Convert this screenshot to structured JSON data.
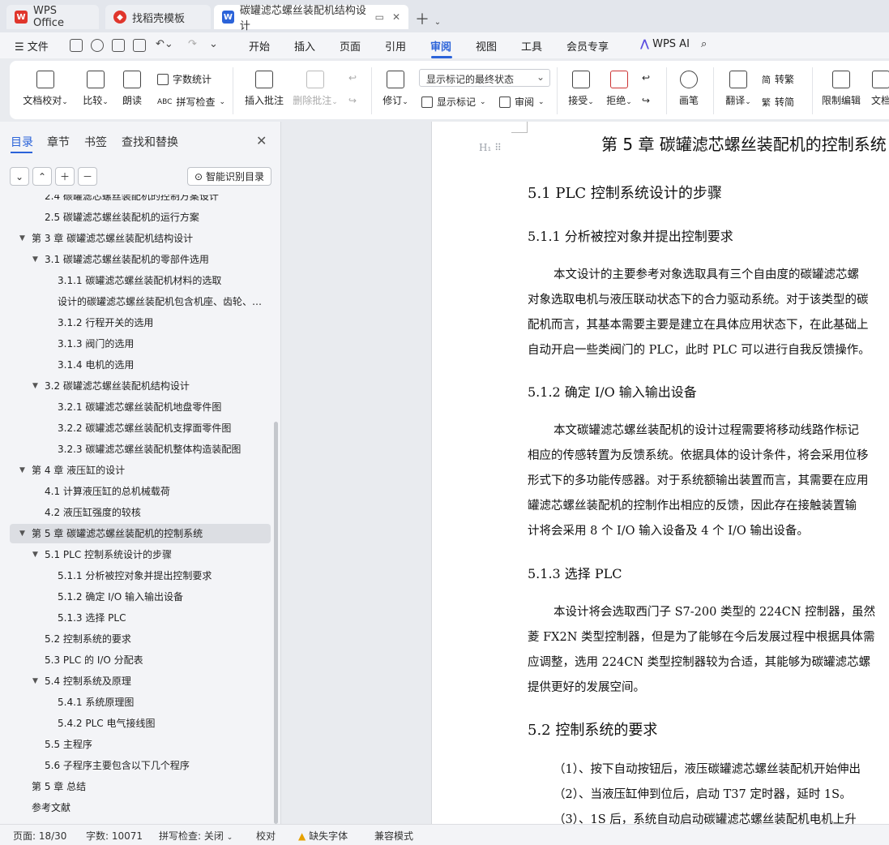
{
  "tabs": {
    "wps": "WPS Office",
    "template": "找稻壳模板",
    "doc": "碳罐滤芯螺丝装配机结构设计"
  },
  "menu": {
    "file": "文件",
    "items": [
      "开始",
      "插入",
      "页面",
      "引用",
      "审阅",
      "视图",
      "工具",
      "会员专享"
    ],
    "ai": "WPS AI"
  },
  "ribbon": {
    "doc_check": "文档校对",
    "compare": "比较",
    "read": "朗读",
    "word_count": "字数统计",
    "spell_check": "拼写检查",
    "insert_comment": "插入批注",
    "delete_comment": "删除批注",
    "revise": "修订",
    "markup_state": "显示标记的最终状态",
    "show_markup": "显示标记",
    "review": "审阅",
    "accept": "接受",
    "reject": "拒绝",
    "pen": "画笔",
    "translate": "翻译",
    "to_trad": "转繁",
    "to_simp": "转简",
    "restrict_edit": "限制编辑",
    "doc_more": "文档"
  },
  "sidebar": {
    "tabs": [
      "目录",
      "章节",
      "书签",
      "查找和替换"
    ],
    "smart_button": "智能识别目录",
    "toc": [
      {
        "text": "2.4 碳罐滤芯螺丝装配机的控制方案设计",
        "level": 2
      },
      {
        "text": "2.5 碳罐滤芯螺丝装配机的运行方案",
        "level": 2
      },
      {
        "text": "第 3 章  碳罐滤芯螺丝装配机结构设计",
        "level": 1,
        "arrow": true
      },
      {
        "text": "3.1 碳罐滤芯螺丝装配机的零部件选用",
        "level": 2,
        "arrow": true
      },
      {
        "text": "3.1.1 碳罐滤芯螺丝装配机材料的选取",
        "level": 3
      },
      {
        "text": "设计的碳罐滤芯螺丝装配机包含机座、齿轮、…",
        "level": 3
      },
      {
        "text": "3.1.2 行程开关的选用",
        "level": 3
      },
      {
        "text": "3.1.3 阀门的选用",
        "level": 3
      },
      {
        "text": "3.1.4 电机的选用",
        "level": 3
      },
      {
        "text": "3.2 碳罐滤芯螺丝装配机结构设计",
        "level": 2,
        "arrow": true
      },
      {
        "text": "3.2.1 碳罐滤芯螺丝装配机地盘零件图",
        "level": 3
      },
      {
        "text": "3.2.2 碳罐滤芯螺丝装配机支撑面零件图",
        "level": 3
      },
      {
        "text": "3.2.3 碳罐滤芯螺丝装配机整体构造装配图",
        "level": 3
      },
      {
        "text": "第 4 章  液压缸的设计",
        "level": 1,
        "arrow": true
      },
      {
        "text": "4.1 计算液压缸的总机械载荷",
        "level": 2
      },
      {
        "text": "4.2 液压缸强度的较核",
        "level": 2
      },
      {
        "text": "第 5 章  碳罐滤芯螺丝装配机的控制系统",
        "level": 1,
        "arrow": true,
        "active": true
      },
      {
        "text": "5.1 PLC 控制系统设计的步骤",
        "level": 2,
        "arrow": true
      },
      {
        "text": "5.1.1 分析被控对象并提出控制要求",
        "level": 3
      },
      {
        "text": "5.1.2 确定 I/O 输入输出设备",
        "level": 3
      },
      {
        "text": "5.1.3 选择 PLC",
        "level": 3
      },
      {
        "text": "5.2 控制系统的要求",
        "level": 2
      },
      {
        "text": "5.3 PLC 的 I/O 分配表",
        "level": 2
      },
      {
        "text": "5.4  控制系统及原理",
        "level": 2,
        "arrow": true
      },
      {
        "text": "5.4.1 系统原理图",
        "level": 3
      },
      {
        "text": "5.4.2 PLC 电气接线图",
        "level": 3
      },
      {
        "text": "5.5 主程序",
        "level": 2
      },
      {
        "text": "5.6 子程序主要包含以下几个程序",
        "level": 2
      },
      {
        "text": "第 5 章  总结",
        "level": 1
      },
      {
        "text": "参考文献",
        "level": 1
      }
    ]
  },
  "document": {
    "heading_marker": "H₁",
    "chapter_title": "第 5 章  碳罐滤芯螺丝装配机的控制系统",
    "h_5_1": "5.1 PLC 控制系统设计的步骤",
    "h_5_1_1": "5.1.1 分析被控对象并提出控制要求",
    "p1": [
      "本文设计的主要参考对象选取具有三个自由度的碳罐滤芯螺",
      "对象选取电机与液压联动状态下的合力驱动系统。对于该类型的碳",
      "配机而言，其基本需要主要是建立在具体应用状态下，在此基础上",
      "自动开启一些类阀门的 PLC，此时 PLC 可以进行自我反馈操作。"
    ],
    "h_5_1_2": "5.1.2 确定 I/O 输入输出设备",
    "p2": [
      "本文碳罐滤芯螺丝装配机的设计过程需要将移动线路作标记",
      "相应的传感转置为反馈系统。依据具体的设计条件，将会采用位移",
      "形式下的多功能传感器。对于系统额输出装置而言，其需要在应用",
      "罐滤芯螺丝装配机的控制作出相应的反馈，因此存在接触装置输",
      "计将会采用 8 个 I/O 输入设备及 4 个 I/O 输出设备。"
    ],
    "h_5_1_3": "5.1.3 选择 PLC",
    "p3": [
      "本设计将会选取西门子 S7-200 类型的 224CN 控制器，虽然",
      "菱 FX2N 类型控制器，但是为了能够在今后发展过程中根据具体需",
      "应调整，选用 224CN 类型控制器较为合适，其能够为碳罐滤芯螺",
      "提供更好的发展空间。"
    ],
    "h_5_2": "5.2 控制系统的要求",
    "p4": [
      "（1）、按下自动按钮后，液压碳罐滤芯螺丝装配机开始伸出",
      "（2）、当液压缸伸到位后，启动 T37 定时器，延时 1S。",
      "（3）、1S 后，系统自动启动碳罐滤芯螺丝装配机电机上升"
    ]
  },
  "status": {
    "page": "页面: 18/30",
    "words": "字数: 10071",
    "spell": "拼写检查: 关闭",
    "proof": "校对",
    "missing_font": "缺失字体",
    "compat": "兼容模式"
  },
  "colors": {
    "accent": "#2b63d9",
    "wps_red": "#e0362c"
  }
}
